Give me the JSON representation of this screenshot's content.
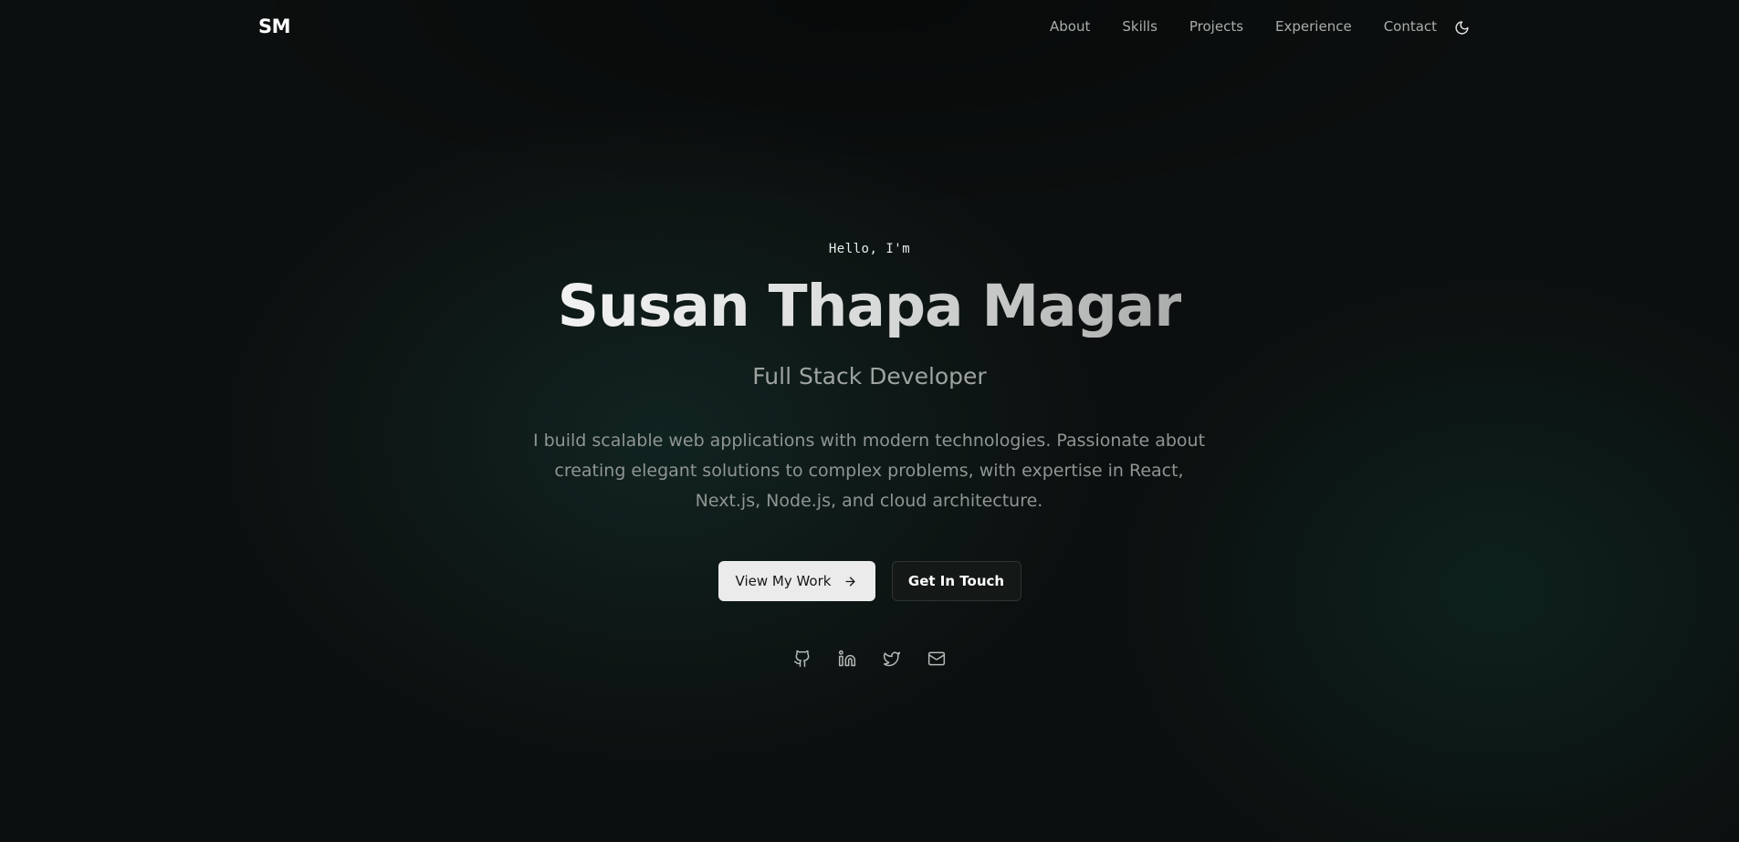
{
  "header": {
    "logo": "SM",
    "nav": [
      {
        "label": "About"
      },
      {
        "label": "Skills"
      },
      {
        "label": "Projects"
      },
      {
        "label": "Experience"
      },
      {
        "label": "Contact"
      }
    ],
    "theme_toggle_icon": "moon-icon"
  },
  "hero": {
    "greeting": "Hello, I'm",
    "name": "Susan Thapa Magar",
    "role": "Full Stack Developer",
    "bio": "I build scalable web applications with modern technologies. Passionate about creating elegant solutions to complex problems, with expertise in React, Next.js, Node.js, and cloud architecture.",
    "primary_button": {
      "label": "View My Work",
      "icon": "arrow-right-icon"
    },
    "secondary_button": {
      "label": "Get In Touch"
    },
    "socials": [
      {
        "icon": "github-icon"
      },
      {
        "icon": "linkedin-icon"
      },
      {
        "icon": "twitter-icon"
      },
      {
        "icon": "mail-icon"
      }
    ]
  },
  "colors": {
    "background": "#0c0f0f",
    "accent_glow": "#14342e",
    "primary_button_bg": "#ebebeb",
    "secondary_button_bg": "#141817"
  }
}
